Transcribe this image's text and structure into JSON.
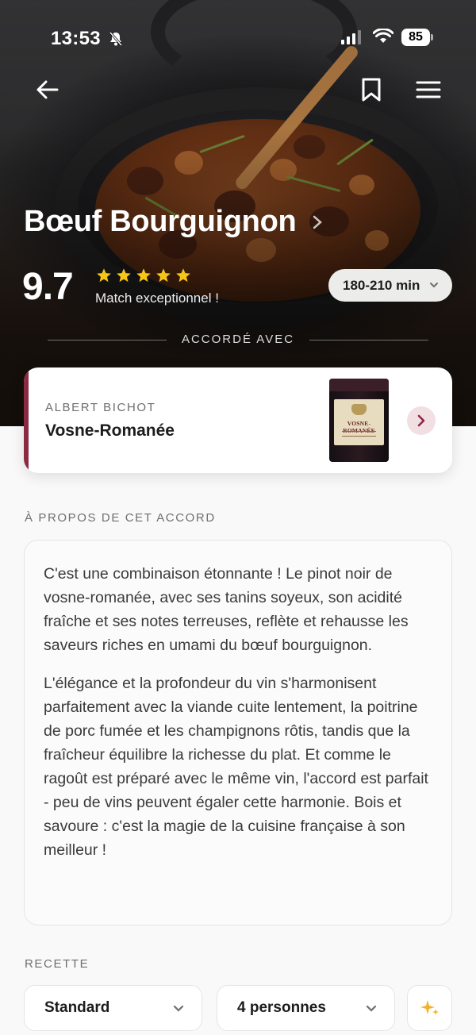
{
  "status_bar": {
    "time": "13:53",
    "battery": "85"
  },
  "dish": {
    "title": "Bœuf Bourguignon",
    "score": "9.7",
    "stars": 5,
    "match_text": "Match exceptionnel !",
    "cook_time": "180-210 min"
  },
  "pairing_heading": "ACCORDÉ AVEC",
  "wine": {
    "producer": "ALBERT BICHOT",
    "name": "Vosne-Romanée",
    "bottle_label": "VOSNE-ROMANÉE",
    "accent_color": "#8b2a43"
  },
  "about": {
    "heading": "À PROPOS DE CET ACCORD",
    "paragraphs": [
      "C'est une combinaison étonnante ! Le pinot noir de vosne-romanée, avec ses tanins soyeux, son acidité fraîche et ses notes terreuses, reflète et rehausse les saveurs riches en umami du bœuf bourguignon.",
      "L'élégance et la profondeur du vin s'harmonisent parfaitement avec la viande cuite lentement, la poitrine de porc fumée et les champignons rôtis, tandis que la fraîcheur équilibre la richesse du plat. Et comme le ragoût est préparé avec le même vin, l'accord est parfait - peu de vins peuvent égaler cette harmonie. Bois et savoure : c'est la magie de la cuisine française à son meilleur !"
    ]
  },
  "recipe": {
    "heading": "RECETTE",
    "variant": "Standard",
    "servings": "4 personnes"
  },
  "icons": {
    "back": "arrow-left-icon",
    "bookmark": "bookmark-icon",
    "menu": "hamburger-menu-icon",
    "star_color": "#f5c518",
    "sparkle_color": "#f0b429"
  }
}
